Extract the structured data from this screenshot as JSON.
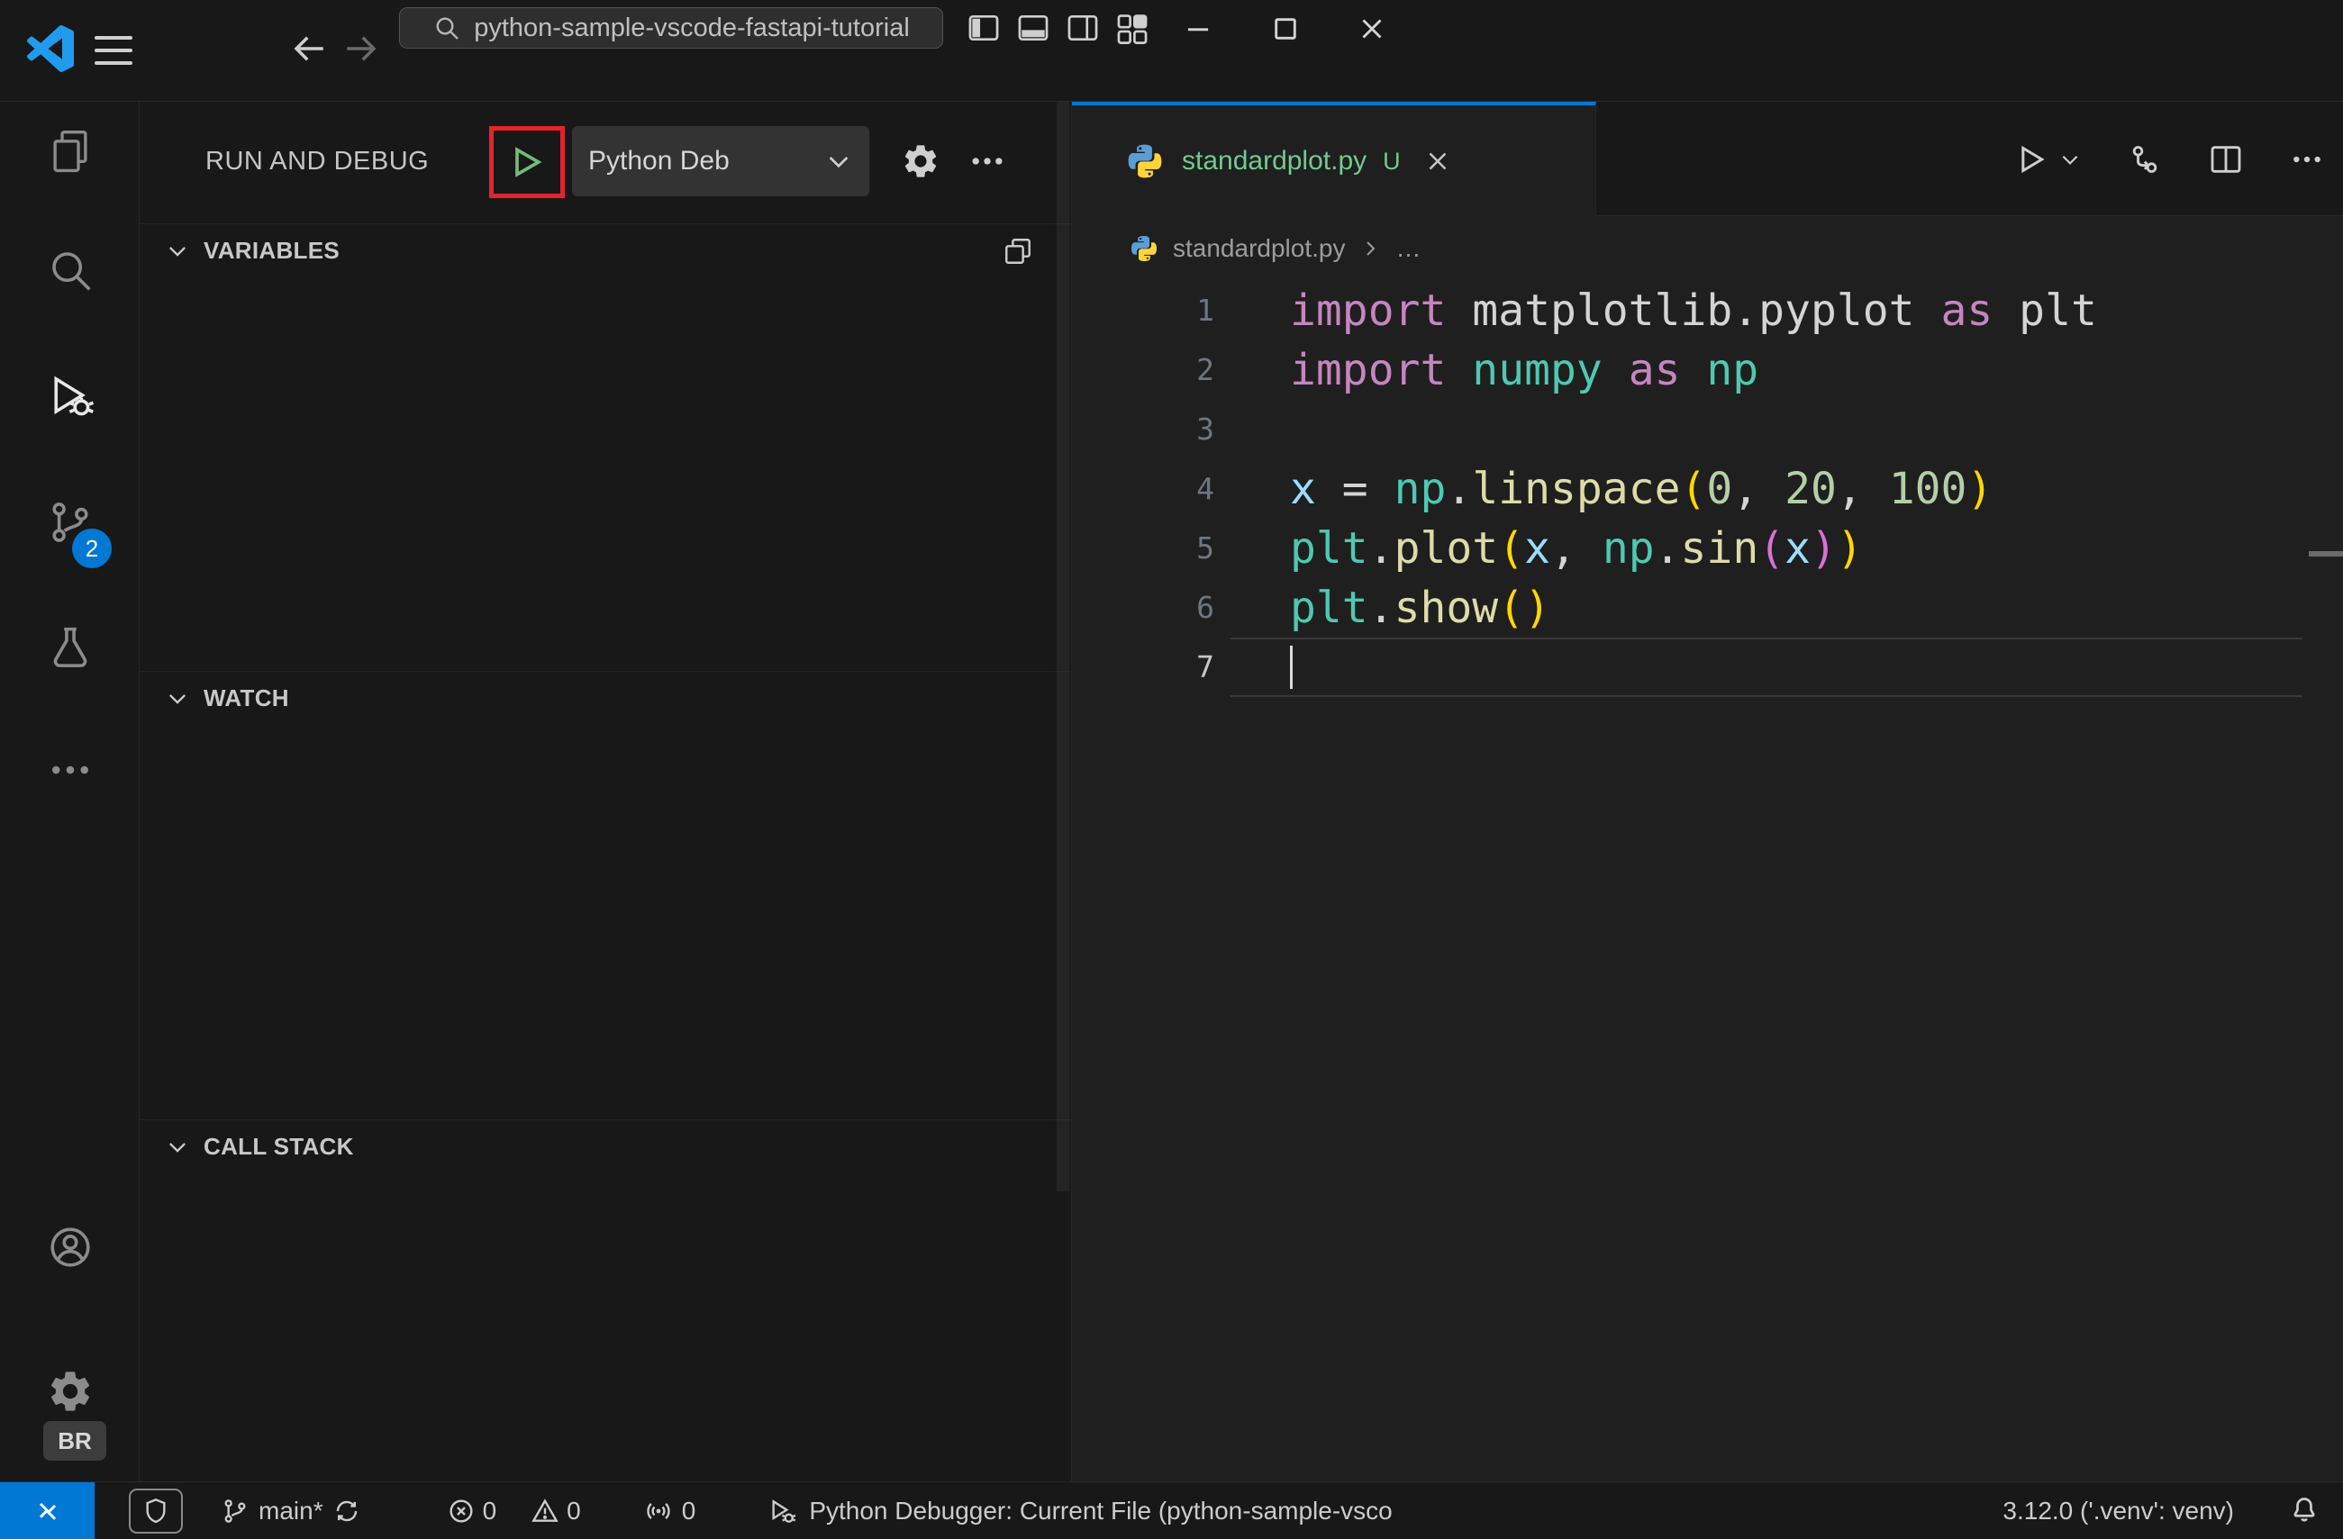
{
  "window": {
    "search_label": "python-sample-vscode-fastapi-tutorial"
  },
  "activity_bar": {
    "scm_badge": "2",
    "profile_badge": "BR"
  },
  "sidebar": {
    "title": "RUN AND DEBUG",
    "debug_dropdown": "Python Deb",
    "sections": {
      "variables": "VARIABLES",
      "watch": "WATCH",
      "call_stack": "CALL STACK"
    }
  },
  "editor": {
    "tab_label": "standardplot.py",
    "tab_modified": "U",
    "breadcrumb_file": "standardplot.py",
    "breadcrumb_more": "…",
    "token_colors": {
      "keyword": "#C586C0",
      "plain": "#d4d4d4",
      "module": "#4EC9B0",
      "variable": "#9CDCFE",
      "function": "#DCDCAA",
      "number": "#B5CEA8",
      "bracket_level1": "#FFD700",
      "bracket_level2": "#DA70D6"
    },
    "lines": [
      {
        "num": "1",
        "segments": [
          {
            "t": "import",
            "c": "kw"
          },
          {
            "t": " matplotlib.pyplot ",
            "c": "plain"
          },
          {
            "t": "as",
            "c": "kw"
          },
          {
            "t": " plt",
            "c": "plain"
          }
        ]
      },
      {
        "num": "2",
        "segments": [
          {
            "t": "import",
            "c": "kw"
          },
          {
            "t": " numpy ",
            "c": "mod"
          },
          {
            "t": "as",
            "c": "kw"
          },
          {
            "t": " np",
            "c": "mod"
          }
        ]
      },
      {
        "num": "3",
        "segments": []
      },
      {
        "num": "4",
        "segments": [
          {
            "t": "x",
            "c": "var"
          },
          {
            "t": " = ",
            "c": "plain"
          },
          {
            "t": "np",
            "c": "mod"
          },
          {
            "t": ".",
            "c": "plain"
          },
          {
            "t": "linspace",
            "c": "fn"
          },
          {
            "t": "(",
            "c": "b1"
          },
          {
            "t": "0",
            "c": "num"
          },
          {
            "t": ", ",
            "c": "plain"
          },
          {
            "t": "20",
            "c": "num"
          },
          {
            "t": ", ",
            "c": "plain"
          },
          {
            "t": "100",
            "c": "num"
          },
          {
            "t": ")",
            "c": "b1"
          }
        ]
      },
      {
        "num": "5",
        "segments": [
          {
            "t": "plt",
            "c": "mod"
          },
          {
            "t": ".",
            "c": "plain"
          },
          {
            "t": "plot",
            "c": "fn"
          },
          {
            "t": "(",
            "c": "b1"
          },
          {
            "t": "x",
            "c": "var"
          },
          {
            "t": ", ",
            "c": "plain"
          },
          {
            "t": "np",
            "c": "mod"
          },
          {
            "t": ".",
            "c": "plain"
          },
          {
            "t": "sin",
            "c": "fn"
          },
          {
            "t": "(",
            "c": "b2"
          },
          {
            "t": "x",
            "c": "var"
          },
          {
            "t": ")",
            "c": "b2"
          },
          {
            "t": ")",
            "c": "b1"
          }
        ]
      },
      {
        "num": "6",
        "segments": [
          {
            "t": "plt",
            "c": "mod"
          },
          {
            "t": ".",
            "c": "plain"
          },
          {
            "t": "show",
            "c": "fn"
          },
          {
            "t": "(",
            "c": "b1"
          },
          {
            "t": ")",
            "c": "b1"
          }
        ]
      },
      {
        "num": "7",
        "segments": [],
        "active": true,
        "cursor": true
      }
    ]
  },
  "status_bar": {
    "branch": "main*",
    "error_count": "0",
    "warning_count": "0",
    "port_count": "0",
    "debugger_label": "Python Debugger: Current File (python-sample-vsco",
    "interpreter": "3.12.0 ('.venv': venv)"
  },
  "colors": {
    "accent_blue": "#0078d4",
    "untracked_green": "#73C991",
    "annotation_red": "#e3242b",
    "debug_play_green": "#75BB78",
    "titlebar_bg": "#181818",
    "editor_bg": "#1f1f1f"
  }
}
